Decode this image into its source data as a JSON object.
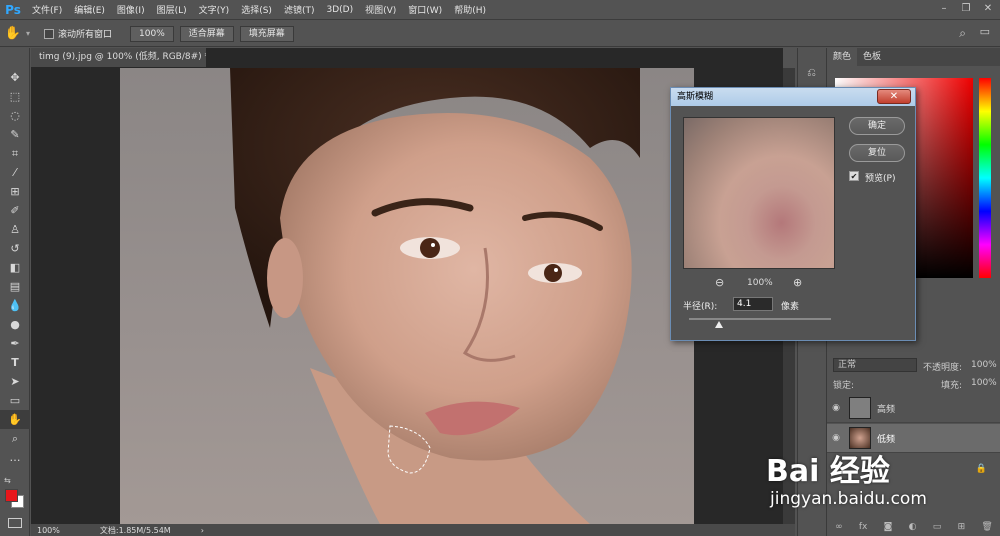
{
  "app": {
    "logo": "Ps"
  },
  "menu": [
    "文件(F)",
    "编辑(E)",
    "图像(I)",
    "图层(L)",
    "文字(Y)",
    "选择(S)",
    "滤镜(T)",
    "3D(D)",
    "视图(V)",
    "窗口(W)",
    "帮助(H)"
  ],
  "options": {
    "scroll_all_label": "滚动所有窗口",
    "zoom_value": "100%",
    "fit_screen_label": "适合屏幕",
    "fill_screen_label": "填充屏幕"
  },
  "document": {
    "tab_title": "timg (9).jpg @ 100% (低频, RGB/8#) *",
    "tab_close": "×"
  },
  "status": {
    "zoom": "100%",
    "doc_info": "文档:1.85M/5.54M",
    "arrow": "›"
  },
  "dialog": {
    "title": "高斯模糊",
    "close": "✕",
    "ok_label": "确定",
    "reset_label": "复位",
    "preview_label": "预览(P)",
    "preview_checked": "✔",
    "zoom_value": "100%",
    "zoom_out_icon": "⊖",
    "zoom_in_icon": "⊕",
    "radius_label": "半径(R):",
    "radius_value": "4.1",
    "radius_unit": "像素"
  },
  "panels": {
    "color_tab": "颜色",
    "swatches_tab": "色板",
    "blend_mode": "正常",
    "opacity_label": "不透明度:",
    "opacity_value": "100%",
    "lock_label": "锁定:",
    "fill_label": "填充:",
    "fill_value": "100%",
    "layers": [
      {
        "name": "高频"
      },
      {
        "name": "低频"
      }
    ]
  },
  "watermark": {
    "logo": "Bai 经验",
    "url": "jingyan.baidu.com"
  },
  "colors": {
    "foreground": "#e8161b",
    "background": "#ffffff",
    "accent": "#31a8ff"
  }
}
